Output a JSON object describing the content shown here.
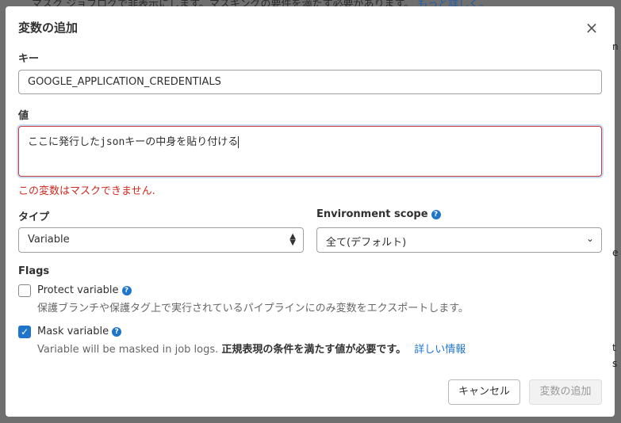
{
  "background": {
    "top_text": "マスク ジョブログで非表示にします。マスキングの要件を満たす必要があります。",
    "top_link": "もっと詳しく。"
  },
  "dialog": {
    "title": "変数の追加",
    "close_icon": "×",
    "key_label": "キー",
    "key_value": "GOOGLE_APPLICATION_CREDENTIALS",
    "value_label": "値",
    "value_text": "ここに発行したjsonキーの中身を貼り付ける",
    "error_text": "この変数はマスクできません.",
    "type_label": "タイプ",
    "type_value": "Variable",
    "env_label": "Environment scope",
    "env_value": "全て(デフォルト)",
    "flags_label": "Flags",
    "protect": {
      "label": "Protect variable",
      "checked": false,
      "description": "保護ブランチや保護タグ上で実行されているパイプラインにのみ変数をエクスポートします。"
    },
    "mask": {
      "label": "Mask variable",
      "checked": true,
      "description": "Variable will be masked in job logs.",
      "requirement": "正規表現の条件を満たす値が必要です。",
      "link": "詳しい情報"
    },
    "cancel_label": "キャンセル",
    "submit_label": "変数の追加"
  },
  "colors": {
    "accent": "#1f75cb",
    "error": "#d0291f"
  }
}
